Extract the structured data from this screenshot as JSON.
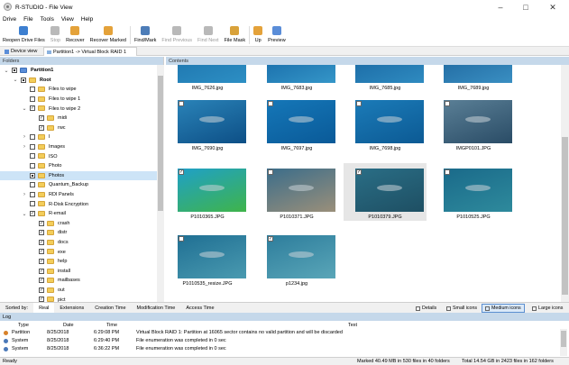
{
  "window": {
    "title": "R-STUDIO - File View"
  },
  "menu": [
    "Drive",
    "File",
    "Tools",
    "View",
    "Help"
  ],
  "toolbar": [
    {
      "label": "Reopen Drive Files",
      "icon": "reopen-icon",
      "disabled": false
    },
    {
      "label": "Stop",
      "icon": "stop-icon",
      "disabled": true
    },
    {
      "label": "Recover",
      "icon": "recover-icon",
      "disabled": false
    },
    {
      "label": "Recover Marked",
      "icon": "recover-marked-icon",
      "disabled": false
    },
    {
      "label": "Find/Mark",
      "icon": "find-mark-icon",
      "disabled": false
    },
    {
      "label": "Find Previous",
      "icon": "find-previous-icon",
      "disabled": true
    },
    {
      "label": "Find Next",
      "icon": "find-next-icon",
      "disabled": true
    },
    {
      "label": "File Mask",
      "icon": "file-mask-icon",
      "disabled": false
    },
    {
      "label": "Up",
      "icon": "up-icon",
      "disabled": false
    },
    {
      "label": "Preview",
      "icon": "preview-icon",
      "disabled": false
    }
  ],
  "tabs": [
    "Device view",
    "Partition1 -> Virtual Block RAID 1"
  ],
  "folders": {
    "header": "Folders",
    "items": [
      {
        "label": "Partition1",
        "depth": 0,
        "exp": "open",
        "check": "mixed",
        "icon": "partition",
        "bold": true
      },
      {
        "label": "Root",
        "depth": 1,
        "exp": "open",
        "check": "mixed",
        "icon": "folder",
        "bold": true
      },
      {
        "label": "Files to wipe",
        "depth": 2,
        "exp": "",
        "check": "",
        "icon": "folder"
      },
      {
        "label": "Files to wipe 1",
        "depth": 2,
        "exp": "",
        "check": "",
        "icon": "folder"
      },
      {
        "label": "Files to wipe 2",
        "depth": 2,
        "exp": "open",
        "check": "✓",
        "icon": "folder"
      },
      {
        "label": "midi",
        "depth": 3,
        "exp": "",
        "check": "✓",
        "icon": "folder"
      },
      {
        "label": "rwc",
        "depth": 3,
        "exp": "",
        "check": "✓",
        "icon": "folder"
      },
      {
        "label": "I",
        "depth": 2,
        "exp": "closed",
        "check": "",
        "icon": "folder"
      },
      {
        "label": "Images",
        "depth": 2,
        "exp": "closed",
        "check": "",
        "icon": "folder"
      },
      {
        "label": "ISO",
        "depth": 2,
        "exp": "",
        "check": "",
        "icon": "folder"
      },
      {
        "label": "Photo",
        "depth": 2,
        "exp": "",
        "check": "",
        "icon": "folder"
      },
      {
        "label": "Photos",
        "depth": 2,
        "exp": "",
        "check": "mixed",
        "icon": "folder",
        "selected": true
      },
      {
        "label": "Quantum_Backup",
        "depth": 2,
        "exp": "",
        "check": "",
        "icon": "folder"
      },
      {
        "label": "RDI Panels",
        "depth": 2,
        "exp": "closed",
        "check": "",
        "icon": "folder"
      },
      {
        "label": "R-Disk Encryption",
        "depth": 2,
        "exp": "",
        "check": "",
        "icon": "folder"
      },
      {
        "label": "R-email",
        "depth": 2,
        "exp": "open",
        "check": "✓",
        "icon": "folder"
      },
      {
        "label": "crash",
        "depth": 3,
        "exp": "",
        "check": "✓",
        "icon": "folder"
      },
      {
        "label": "distr",
        "depth": 3,
        "exp": "",
        "check": "✓",
        "icon": "folder"
      },
      {
        "label": "docs",
        "depth": 3,
        "exp": "",
        "check": "✓",
        "icon": "folder"
      },
      {
        "label": "exe",
        "depth": 3,
        "exp": "",
        "check": "✓",
        "icon": "folder"
      },
      {
        "label": "help",
        "depth": 3,
        "exp": "",
        "check": "✓",
        "icon": "folder"
      },
      {
        "label": "install",
        "depth": 3,
        "exp": "",
        "check": "✓",
        "icon": "folder"
      },
      {
        "label": "mailbases",
        "depth": 3,
        "exp": "",
        "check": "✓",
        "icon": "folder"
      },
      {
        "label": "out",
        "depth": 3,
        "exp": "",
        "check": "✓",
        "icon": "folder"
      },
      {
        "label": "pict",
        "depth": 3,
        "exp": "",
        "check": "✓",
        "icon": "folder"
      },
      {
        "label": "to_help",
        "depth": 3,
        "exp": "",
        "check": "✓",
        "icon": "folder"
      }
    ]
  },
  "content": {
    "header": "Contents",
    "items": [
      {
        "name": "IMG_7626.jpg",
        "checked": false,
        "colors": [
          "#1a6ea8",
          "#2d8fc4"
        ]
      },
      {
        "name": "IMG_7683.jpg",
        "checked": false,
        "colors": [
          "#0f5fa0",
          "#3596c8"
        ]
      },
      {
        "name": "IMG_7685.jpg",
        "checked": false,
        "colors": [
          "#145f9c",
          "#2f8bc0"
        ]
      },
      {
        "name": "IMG_7689.jpg",
        "checked": false,
        "colors": [
          "#185d96",
          "#3a8fc2"
        ]
      },
      {
        "name": "IMG_7690.jpg",
        "checked": false,
        "colors": [
          "#2a83b8",
          "#0d4f86"
        ]
      },
      {
        "name": "IMG_7697.jpg",
        "checked": false,
        "colors": [
          "#1577b8",
          "#0a5a98"
        ]
      },
      {
        "name": "IMG_7698.jpg",
        "checked": false,
        "colors": [
          "#1b7bb8",
          "#0c5a94"
        ]
      },
      {
        "name": "IMGP0101.JPG",
        "checked": false,
        "colors": [
          "#5a7f96",
          "#2a4c66"
        ]
      },
      {
        "name": "P1010365.JPG",
        "checked": true,
        "colors": [
          "#1fa0c8",
          "#3fb44a"
        ]
      },
      {
        "name": "P1010371.JPG",
        "checked": false,
        "colors": [
          "#3b6d8a",
          "#9a8f7a"
        ]
      },
      {
        "name": "P1010379.JPG",
        "checked": true,
        "colors": [
          "#2a6e86",
          "#1e4f63"
        ],
        "selected": true
      },
      {
        "name": "P1010525.JPG",
        "checked": false,
        "colors": [
          "#1a6a8a",
          "#2e8a9c"
        ]
      },
      {
        "name": "P1010535_resize.JPG",
        "checked": false,
        "colors": [
          "#1f6f93",
          "#4a9ab0"
        ]
      },
      {
        "name": "p1234.jpg",
        "checked": true,
        "colors": [
          "#2d7d9c",
          "#5aa6b8"
        ]
      }
    ]
  },
  "sortbar": {
    "label": "Sorted by:",
    "tabs": [
      "Real",
      "Extensions",
      "Creation Time",
      "Modification Time",
      "Access Time"
    ],
    "active": "Real",
    "views": [
      "Details",
      "Small icons",
      "Medium icons",
      "Large icons"
    ],
    "active_view": "Medium icons"
  },
  "log": {
    "header": "Log",
    "columns": [
      "Type",
      "Date",
      "Time",
      "Text"
    ],
    "rows": [
      {
        "type": "Partition",
        "date": "8/25/2018",
        "time": "6:29:08 PM",
        "text": "Virtual Block RAID 1: Partition at 16065 sector contains no valid partition and will be discarded"
      },
      {
        "type": "System",
        "date": "8/25/2018",
        "time": "6:29:40 PM",
        "text": "File enumeration was completed in 0 sec"
      },
      {
        "type": "System",
        "date": "8/25/2018",
        "time": "6:36:22 PM",
        "text": "File enumeration was completed in 0 sec"
      }
    ]
  },
  "status": {
    "left": "Ready",
    "marked": "Marked 40.49 MB in 530 files in 40 folders",
    "total": "Total 14.54 GB in 2423 files in 162 folders"
  }
}
